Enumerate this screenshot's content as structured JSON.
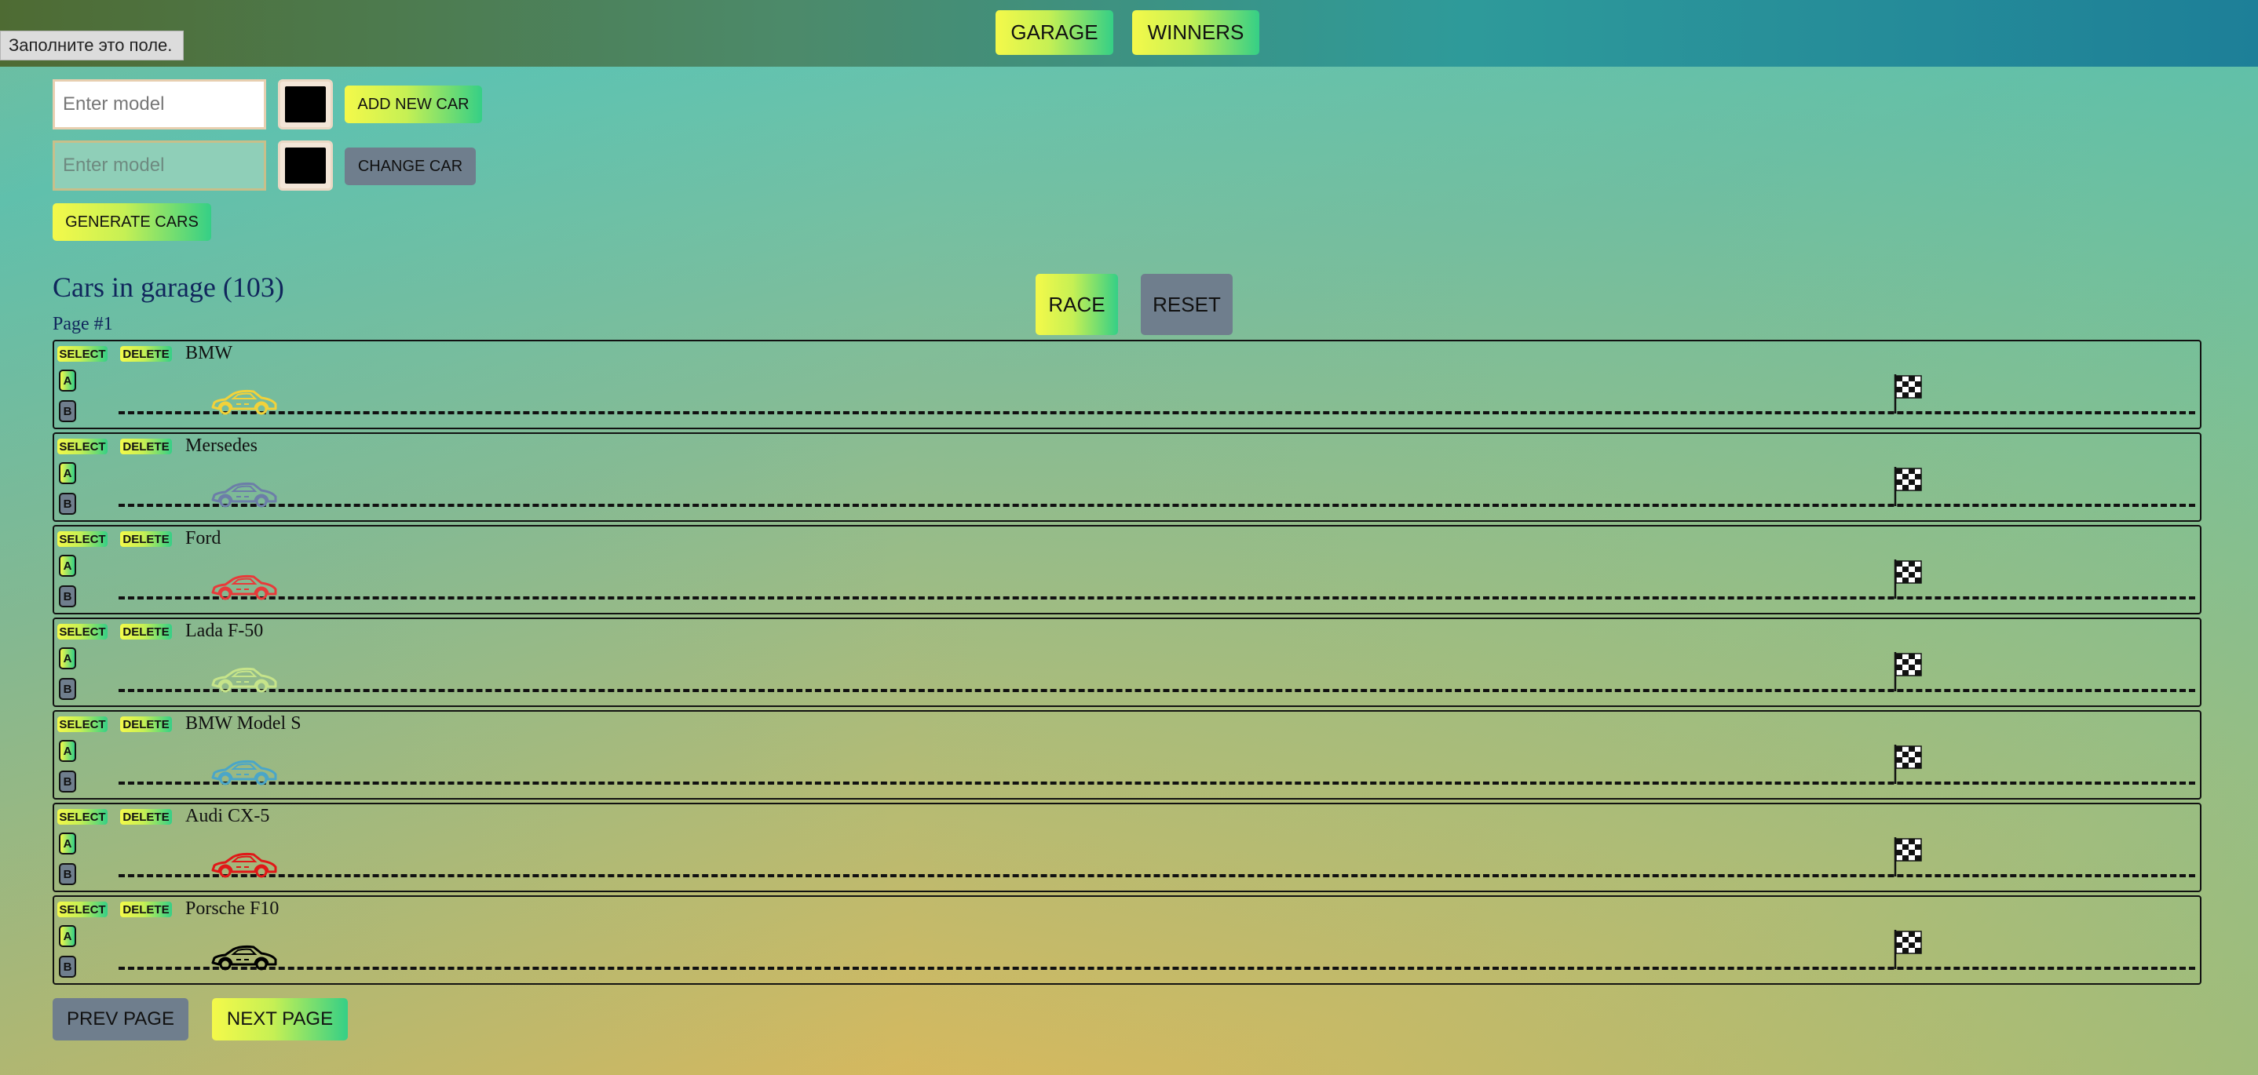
{
  "tooltip": "Заполните это поле.",
  "nav": {
    "garage": "GARAGE",
    "winners": "WINNERS"
  },
  "create_form": {
    "placeholder": "Enter model",
    "color": "#000000",
    "submit": "ADD NEW CAR"
  },
  "update_form": {
    "placeholder": "Enter model",
    "color": "#000000",
    "submit": "CHANGE CAR"
  },
  "generate": "GENERATE CARS",
  "race_controls": {
    "race": "RACE",
    "reset": "RESET"
  },
  "garage": {
    "title": "Cars in garage (103)",
    "page": "Page #1"
  },
  "car_controls": {
    "select": "SELECT",
    "remove": "DELETE",
    "start": "A",
    "stop": "B"
  },
  "cars": [
    {
      "name": "BMW",
      "color": "#f2d23a"
    },
    {
      "name": "Mersedes",
      "color": "#6c7ea8"
    },
    {
      "name": "Ford",
      "color": "#e83a3a"
    },
    {
      "name": "Lada F-50",
      "color": "#c6e48a"
    },
    {
      "name": "BMW Model S",
      "color": "#4aa6c8"
    },
    {
      "name": "Audi CX-5",
      "color": "#e01818"
    },
    {
      "name": "Porsche F10",
      "color": "#000000"
    }
  ],
  "pagination": {
    "prev": "PREV PAGE",
    "next": "NEXT PAGE"
  },
  "colors": {
    "accent_gradient_start": "#f4f94a",
    "accent_gradient_end": "#35cf86",
    "disabled_button": "#6f7e8d",
    "heading": "#10265c"
  }
}
